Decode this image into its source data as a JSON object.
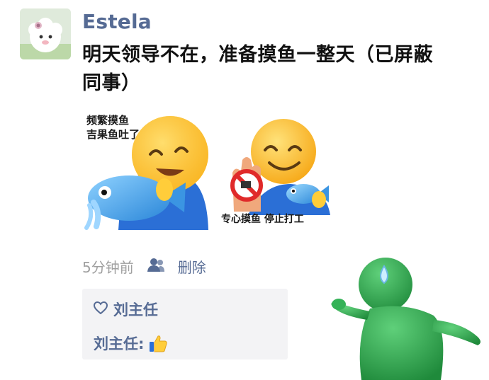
{
  "post": {
    "author": "Estela",
    "text_line1": "明天领导不在，准备摸鱼一整天（已屏蔽",
    "text_line2": "同事）"
  },
  "stickers": [
    {
      "caption_line1": "频繁摸鱼",
      "caption_line2": "吉果鱼吐了"
    },
    {
      "caption": "专心摸鱼 停止打工"
    }
  ],
  "meta": {
    "time": "5分钟前",
    "delete_label": "删除"
  },
  "comments": {
    "likes": "刘主任",
    "comment_author": "刘主任:"
  },
  "colors": {
    "link_blue": "#566b94",
    "comment_bg": "#f3f3f5",
    "emoji_yellow": "#ffcd3a",
    "runner_green": "#2fa04a"
  }
}
